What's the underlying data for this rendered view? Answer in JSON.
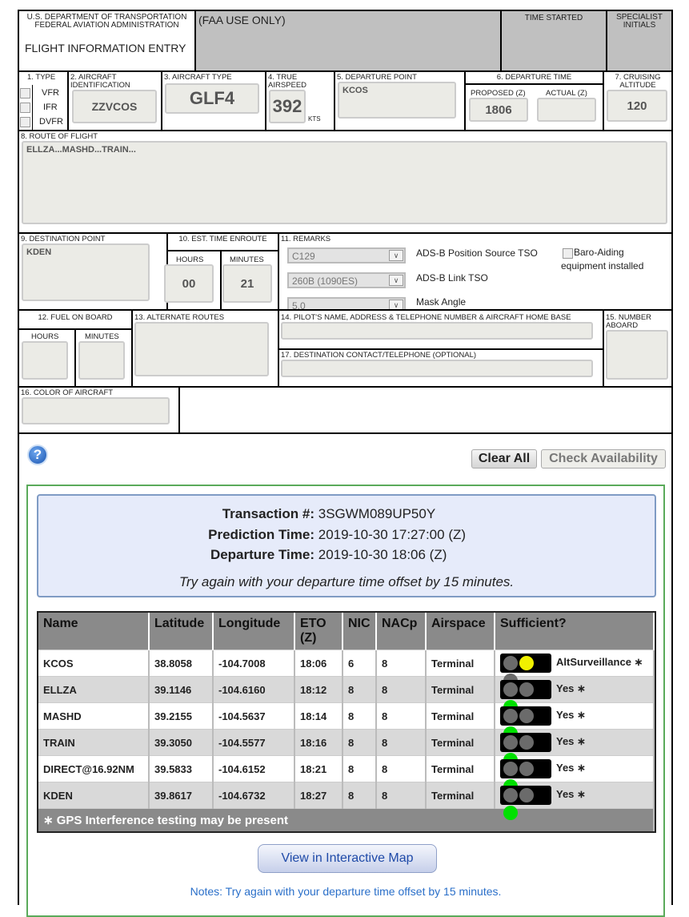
{
  "header": {
    "dept": "U.S. DEPARTMENT OF TRANSPORTATION",
    "agency": "FEDERAL AVIATION ADMINISTRATION",
    "title": "FLIGHT INFORMATION ENTRY",
    "faa_use": "(FAA USE ONLY)",
    "time_started": "TIME STARTED",
    "specialist": "SPECIALIST INITIALS"
  },
  "form": {
    "type_label": "1. TYPE",
    "types": [
      "VFR",
      "IFR",
      "DVFR"
    ],
    "aircraft_id_label": "2. AIRCRAFT IDENTIFICATION",
    "aircraft_id": "ZZVCOS",
    "aircraft_type_label": "3. AIRCRAFT TYPE",
    "aircraft_type": "GLF4",
    "airspeed_label": "4. TRUE AIRSPEED",
    "airspeed": "392",
    "airspeed_unit": "KTS",
    "departure_point_label": "5. DEPARTURE POINT",
    "departure_point": "KCOS",
    "departure_time_label": "6. DEPARTURE TIME",
    "proposed_label": "PROPOSED (Z)",
    "proposed": "1806",
    "actual_label": "ACTUAL (Z)",
    "actual": "",
    "altitude_label": "7. CRUISING ALTITUDE",
    "altitude": "120",
    "route_label": "8. ROUTE OF FLIGHT",
    "route": "ELLZA...MASHD...TRAIN...",
    "destination_label": "9. DESTINATION POINT",
    "destination": "KDEN",
    "ete_label": "10. EST. TIME ENROUTE",
    "hours_label": "HOURS",
    "minutes_label": "MINUTES",
    "ete_hours": "00",
    "ete_minutes": "21",
    "remarks_label": "11. REMARKS",
    "position_source": "C129",
    "position_source_label": "ADS-B Position Source TSO",
    "link_tso": "260B (1090ES)",
    "link_tso_label": "ADS-B Link TSO",
    "mask_angle": "5.0",
    "mask_angle_label": "Mask Angle",
    "baro_label": "Baro-Aiding equipment installed",
    "fuel_label": "12. FUEL ON BOARD",
    "alternate_label": "13. ALTERNATE ROUTES",
    "pilot_label": "14. PILOT'S NAME, ADDRESS & TELEPHONE NUMBER & AIRCRAFT HOME BASE",
    "aboard_label": "15. NUMBER ABOARD",
    "color_label": "16. COLOR OF AIRCRAFT",
    "contact_label": "17. DESTINATION CONTACT/TELEPHONE (OPTIONAL)"
  },
  "actions": {
    "help": "?",
    "clear_all": "Clear All",
    "check_availability": "Check Availability"
  },
  "result": {
    "transaction_label": "Transaction #:",
    "transaction": "3SGWM089UP50Y",
    "prediction_label": "Prediction Time:",
    "prediction": "2019-10-30 17:27:00 (Z)",
    "departure_label": "Departure Time:",
    "departure": "2019-10-30 18:06 (Z)",
    "message": "Try again with your departure time offset by 15 minutes.",
    "columns": [
      "Name",
      "Latitude",
      "Longitude",
      "ETO (Z)",
      "NIC",
      "NACp",
      "Airspace",
      "Sufficient?"
    ],
    "rows": [
      {
        "name": "KCOS",
        "lat": "38.8058",
        "lon": "-104.7008",
        "eto": "18:06",
        "nic": "6",
        "nacp": "8",
        "airspace": "Terminal",
        "light": "yellow",
        "status": "AltSurveillance ∗"
      },
      {
        "name": "ELLZA",
        "lat": "39.1146",
        "lon": "-104.6160",
        "eto": "18:12",
        "nic": "8",
        "nacp": "8",
        "airspace": "Terminal",
        "light": "green",
        "status": "Yes ∗"
      },
      {
        "name": "MASHD",
        "lat": "39.2155",
        "lon": "-104.5637",
        "eto": "18:14",
        "nic": "8",
        "nacp": "8",
        "airspace": "Terminal",
        "light": "green",
        "status": "Yes ∗"
      },
      {
        "name": "TRAIN",
        "lat": "39.3050",
        "lon": "-104.5577",
        "eto": "18:16",
        "nic": "8",
        "nacp": "8",
        "airspace": "Terminal",
        "light": "green",
        "status": "Yes ∗"
      },
      {
        "name": "DIRECT@16.92NM",
        "lat": "39.5833",
        "lon": "-104.6152",
        "eto": "18:21",
        "nic": "8",
        "nacp": "8",
        "airspace": "Terminal",
        "light": "green",
        "status": "Yes ∗"
      },
      {
        "name": "KDEN",
        "lat": "39.8617",
        "lon": "-104.6732",
        "eto": "18:27",
        "nic": "8",
        "nacp": "8",
        "airspace": "Terminal",
        "light": "green",
        "status": "Yes ∗"
      }
    ],
    "footnote": "∗ GPS Interference testing may be present",
    "map_button": "View in Interactive Map",
    "notes": "Notes: Try again with your departure time offset by 15 minutes."
  },
  "colors": {
    "faa_gray": "#c0c0c0",
    "green_border": "#5aaa5a",
    "info_bg": "#e6ebfa",
    "yellow": "#f0f000",
    "green": "#00e000",
    "link_blue": "#2a6fc9"
  }
}
